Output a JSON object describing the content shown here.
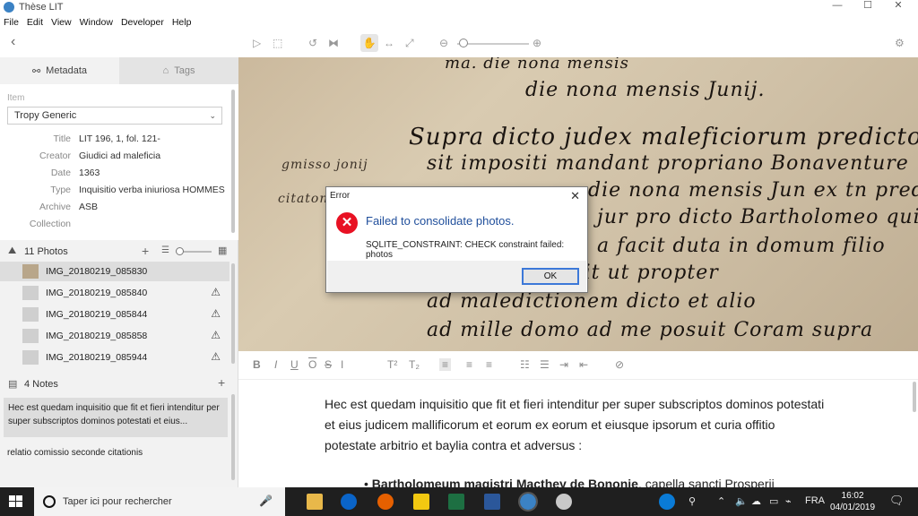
{
  "window": {
    "title": "Thèse LIT",
    "min": "—",
    "max": "☐",
    "close": "✕"
  },
  "menu": [
    "File",
    "Edit",
    "View",
    "Window",
    "Developer",
    "Help"
  ],
  "sidebar": {
    "tabs": {
      "metadata": "Metadata",
      "tags": "Tags"
    },
    "item_label": "Item",
    "template": "Tropy Generic",
    "fields": [
      {
        "key": "Title",
        "value": "LIT 196, 1, fol. 121-"
      },
      {
        "key": "Creator",
        "value": "Giudici ad maleficia"
      },
      {
        "key": "Date",
        "value": "1363"
      },
      {
        "key": "Type",
        "value": "Inquisitio verba iniuriosa HOMMES"
      },
      {
        "key": "Archive",
        "value": "ASB"
      },
      {
        "key": "Collection",
        "value": ""
      }
    ],
    "photos_label": "11 Photos",
    "photos": [
      {
        "name": "IMG_20180219_085830",
        "warning": false
      },
      {
        "name": "IMG_20180219_085840",
        "warning": true
      },
      {
        "name": "IMG_20180219_085844",
        "warning": true
      },
      {
        "name": "IMG_20180219_085858",
        "warning": true
      },
      {
        "name": "IMG_20180219_085944",
        "warning": true
      }
    ],
    "notes_label": "4 Notes",
    "notes": [
      "Hec est quedam inquisitio que fit et fieri intenditur per super subscriptos dominos potestati et eius...",
      "relatio comissio seconde citationis"
    ]
  },
  "viewer": {
    "handwriting": [
      "ma. die nona mensis",
      "die nona mensis Junij.",
      "Supra dicto judex maleficiorum predictorum",
      "sit impositi mandant propriano Bonaventure",
      "die nona mensis Jun ex tn predictos",
      "jur pro dicto Bartholomeo qui",
      "a facit duta in domum filio",
      "juntra ipsa dicit ut propter",
      "ad maledictionem dicto et alio",
      "ad mille domo ad me posuit Coram supra"
    ],
    "margin_text": [
      "gmisso jonij",
      "citatone"
    ]
  },
  "editor": {
    "paragraph": "Hec est quedam inquisitio que fit et fieri intenditur per super subscriptos dominos potestati et eius judicem mallificorum et eorum ex eorum et eiusque ipsorum et curia offitio potestate arbitrio et baylia contra et adversus :",
    "bullet_bold": "Bartholomeum magistri Macthey de Bononie",
    "bullet_rest": ", capella sancti Prosperii"
  },
  "dialog": {
    "title": "Error",
    "heading": "Failed to consolidate photos.",
    "message": "SQLITE_CONSTRAINT: CHECK constraint failed: photos",
    "ok": "OK"
  },
  "taskbar": {
    "search_placeholder": "Taper ici pour rechercher",
    "lang": "FRA",
    "time": "16:02",
    "date": "04/01/2019"
  },
  "colors": {
    "error": "#e81123",
    "dialog_heading": "#1f4e9b",
    "taskbar": "#1f1f1f"
  }
}
